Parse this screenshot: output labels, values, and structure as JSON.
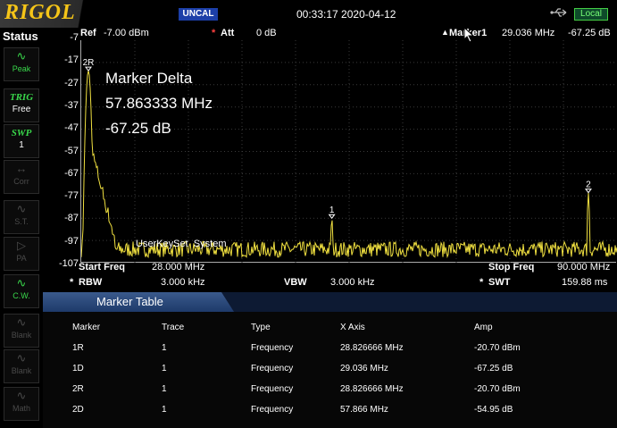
{
  "topbar": {
    "brand": "RIGOL",
    "uncal_badge": "UNCAL",
    "datetime": "00:33:17 2020-04-12",
    "usb_icon": "usb-icon",
    "local_badge": "Local"
  },
  "sidebar": {
    "title": "Status",
    "items": [
      {
        "icon": "peak-icon",
        "label": "Peak",
        "state": "on"
      },
      {
        "icon": "TRIG",
        "label": "Free",
        "state": "trig"
      },
      {
        "icon": "SWP",
        "label": "1",
        "state": "trig"
      },
      {
        "icon": "corr-icon",
        "label": "Corr",
        "state": "off"
      },
      {
        "icon": "st-icon",
        "label": "S.T.",
        "state": "off"
      },
      {
        "icon": "pa-icon",
        "label": "PA",
        "state": "off"
      },
      {
        "icon": "cw-icon",
        "label": "C.W.",
        "state": "on"
      },
      {
        "icon": "blank-icon",
        "label": "Blank",
        "state": "off"
      },
      {
        "icon": "blank-icon",
        "label": "Blank",
        "state": "off"
      },
      {
        "icon": "math-icon",
        "label": "Math",
        "state": "off"
      }
    ]
  },
  "header": {
    "ref_label": "Ref",
    "ref_value": "-7.00 dBm",
    "att_star": "*",
    "att_label": "Att",
    "att_value": "0 dB",
    "marker_prefix": "▲",
    "marker_label": "Marker1",
    "marker_freq": "29.036 MHz",
    "marker_amp": "-67.25 dB"
  },
  "y_axis_labels": [
    "-7",
    "-17",
    "-27",
    "-37",
    "-47",
    "-57",
    "-67",
    "-77",
    "-87",
    "-97",
    "-107"
  ],
  "marker_delta": {
    "title": "Marker Delta",
    "freq": "57.863333 MHz",
    "amp": "-67.25 dB"
  },
  "softkey_text": "UserKeySet  System",
  "chart_data": {
    "type": "line",
    "ylim": [
      -107,
      -7
    ],
    "xlim_mhz": [
      28.0,
      90.0
    ],
    "grid": true,
    "trace_color": "#f0e040",
    "noise_floor_db": -101,
    "peaks": [
      {
        "label": "2R",
        "x_mhz": 28.826666,
        "y_db": -20.7
      },
      {
        "label": "1",
        "x_mhz": 57.0,
        "y_db": -87.0
      },
      {
        "label": "2",
        "x_mhz": 86.69,
        "y_db": -75.5
      }
    ]
  },
  "params": {
    "start_freq_label": "Start Freq",
    "start_freq_value": "28.000 MHz",
    "stop_freq_label": "Stop Freq",
    "stop_freq_value": "90.000 MHz",
    "rbw_star": "*",
    "rbw_label": "RBW",
    "rbw_value": "3.000 kHz",
    "vbw_label": "VBW",
    "vbw_value": "3.000 kHz",
    "swt_star": "*",
    "swt_label": "SWT",
    "swt_value": "159.88 ms"
  },
  "marker_table": {
    "title": "Marker Table",
    "columns": [
      "Marker",
      "Trace",
      "Type",
      "X Axis",
      "Amp"
    ],
    "rows": [
      [
        "1R",
        "1",
        "Frequency",
        "28.826666 MHz",
        "-20.70 dBm"
      ],
      [
        "1D",
        "1",
        "Frequency",
        "29.036 MHz",
        "-67.25 dB"
      ],
      [
        "2R",
        "1",
        "Frequency",
        "28.826666 MHz",
        "-20.70 dBm"
      ],
      [
        "2D",
        "1",
        "Frequency",
        "57.866 MHz",
        "-54.95 dB"
      ]
    ]
  }
}
